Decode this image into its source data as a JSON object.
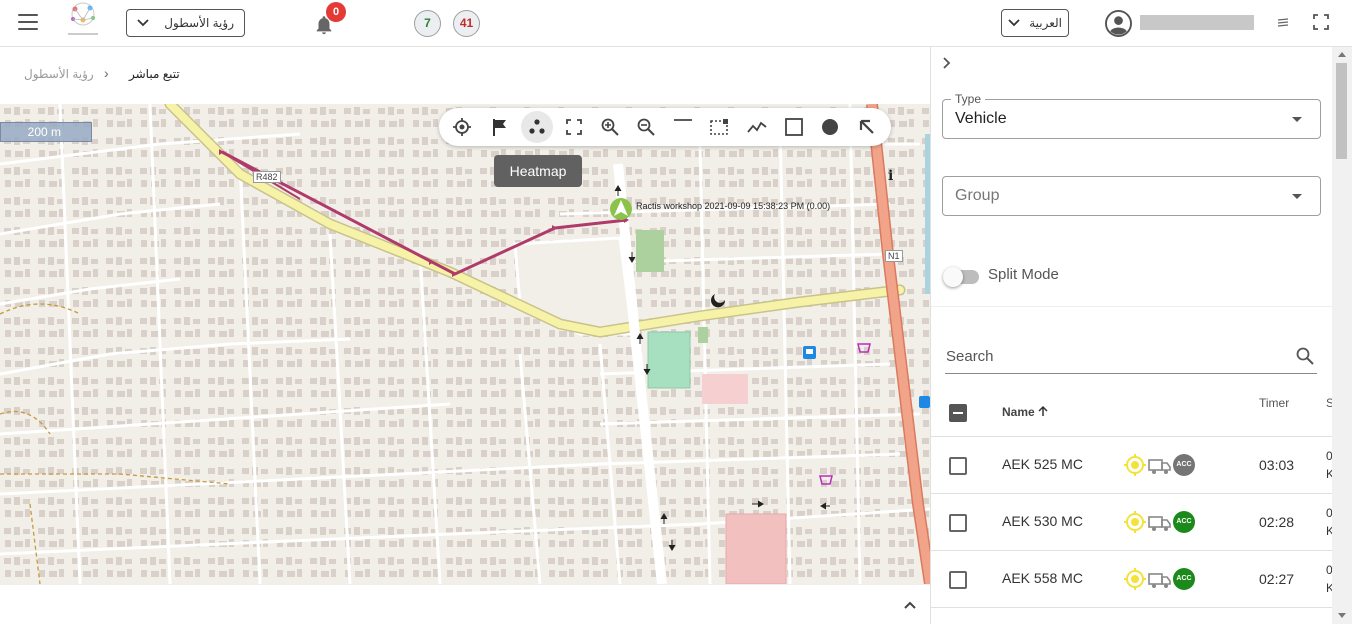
{
  "header": {
    "fleet_selector": "رؤية الأسطول",
    "notifications_count": "0",
    "online_count": "7",
    "offline_count": "41",
    "language": "العربية"
  },
  "breadcrumb": {
    "parent": "رؤية الأسطول",
    "current": "تتبع مباشر"
  },
  "map": {
    "scale": "200 m",
    "tooltip": "Heatmap",
    "marker_label": "Ractis workshop 2021-09-09 15:38:23 PM (0.00)",
    "road_labels": [
      "R482",
      "N1"
    ],
    "toolbar": [
      "locate-icon",
      "flag-icon",
      "heatmap-icon",
      "fit-bounds-icon",
      "zoom-in-icon",
      "zoom-out-icon",
      "measure-line-icon",
      "select-area-icon",
      "polyline-icon",
      "rectangle-icon",
      "circle-icon",
      "arrow-cursor-icon"
    ]
  },
  "panel": {
    "type_label": "Type",
    "type_value": "Vehicle",
    "group_placeholder": "Group",
    "split_mode_label": "Split Mode",
    "search_label": "Search",
    "columns": {
      "name": "Name",
      "timer": "Timer",
      "next": "S"
    },
    "rows": [
      {
        "name": "AEK 525 MC",
        "acc": "ACC",
        "acc_color": "#757575",
        "timer": "03:03",
        "trunc1": "0",
        "trunc2": "K"
      },
      {
        "name": "AEK 530 MC",
        "acc": "ACC",
        "acc_color": "#1b8a1b",
        "timer": "02:28",
        "trunc1": "0",
        "trunc2": "K"
      },
      {
        "name": "AEK 558 MC",
        "acc": "ACC",
        "acc_color": "#1b8a1b",
        "timer": "02:27",
        "trunc1": "0",
        "trunc2": "K"
      }
    ]
  },
  "colors": {
    "route": "#b03a6a",
    "main_road": "#f6f2a8",
    "highway": "#f2a48a",
    "badge_red": "#e53935"
  }
}
